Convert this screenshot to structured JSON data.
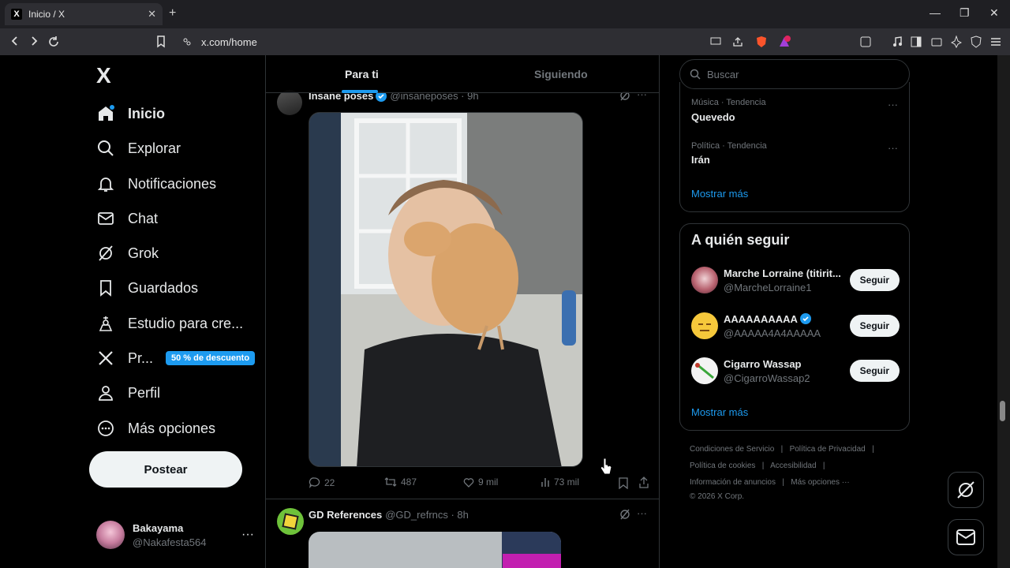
{
  "browser": {
    "tab_title": "Inicio / X",
    "tab_favicon": "X",
    "tab_close": "✕",
    "new_tab": "+",
    "url": "x.com/home",
    "min": "—",
    "max": "❐",
    "close": "✕"
  },
  "nav": {
    "logo": "X",
    "items": [
      {
        "label": "Inicio",
        "icon": "home-icon"
      },
      {
        "label": "Explorar",
        "icon": "search-icon"
      },
      {
        "label": "Notificaciones",
        "icon": "bell-icon"
      },
      {
        "label": "Chat",
        "icon": "mail-icon"
      },
      {
        "label": "Grok",
        "icon": "grok-icon"
      },
      {
        "label": "Guardados",
        "icon": "bookmark-icon"
      },
      {
        "label": "Estudio para cre...",
        "icon": "creator-icon"
      },
      {
        "label": "Pr...",
        "icon": "x-icon",
        "badge": "50 % de descuento"
      },
      {
        "label": "Perfil",
        "icon": "person-icon"
      },
      {
        "label": "Más opciones",
        "icon": "more-circle-icon"
      }
    ],
    "post_button": "Postear",
    "account": {
      "name": "Bakayama",
      "handle": "@Nakafesta564",
      "more": "···"
    }
  },
  "feed": {
    "tabs": [
      "Para ti",
      "Siguiendo"
    ],
    "post1": {
      "name": "Insane poses",
      "handle": "@insaneposes · 9h",
      "more": "···",
      "stats": {
        "replies": "22",
        "reposts": "487",
        "likes": "9 mil",
        "views": "73 mil"
      }
    },
    "post2": {
      "name": "GD References",
      "handle": "@GD_refrncs · 8h",
      "more": "···"
    }
  },
  "sidebar": {
    "search_placeholder": "Buscar",
    "trends": [
      {
        "category": "Música · Tendencia",
        "name": "Quevedo"
      },
      {
        "category": "Política · Tendencia",
        "name": "Irán"
      }
    ],
    "trends_more": "···",
    "trends_show_more": "Mostrar más",
    "follow_title": "A quién seguir",
    "follow": [
      {
        "name": "Marche Lorraine (titirit...",
        "handle": "@MarcheLorraine1",
        "verified": false
      },
      {
        "name": "AAAAAAAAAA",
        "handle": "@AAAAA4A4AAAAA",
        "verified": true
      },
      {
        "name": "Cigarro Wassap",
        "handle": "@CigarroWassap2",
        "verified": false
      }
    ],
    "follow_button": "Seguir",
    "follow_show_more": "Mostrar más",
    "footer": {
      "line1a": "Condiciones de Servicio",
      "line1b": "Política de Privacidad",
      "line2a": "Política de cookies",
      "line2b": "Accesibilidad",
      "line3a": "Información de anuncios",
      "line3b": "Más opciones ···",
      "copyright": "© 2026 X Corp.",
      "sep": "|"
    }
  },
  "colors": {
    "accent": "#1d9bf0",
    "border": "#2f3336",
    "muted": "#71767b"
  }
}
